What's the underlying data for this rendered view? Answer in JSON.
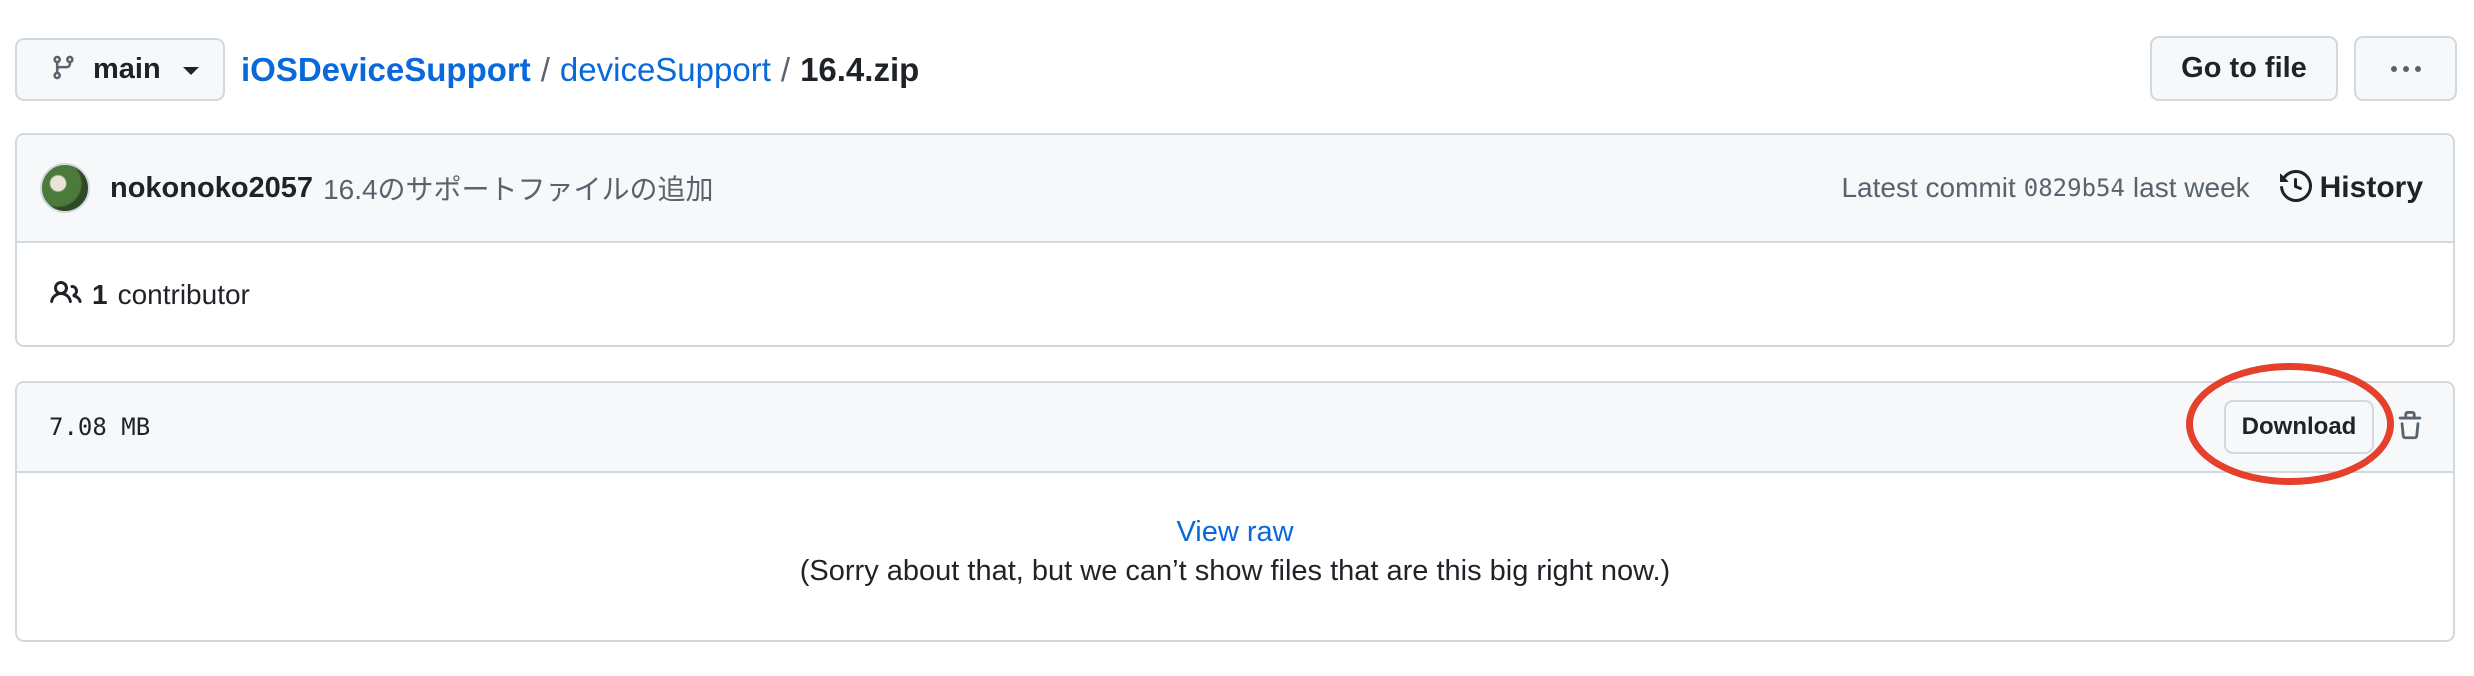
{
  "branch": {
    "name": "main"
  },
  "breadcrumb": {
    "repo": "iOSDeviceSupport",
    "folder": "deviceSupport",
    "file": "16.4.zip",
    "separator": "/"
  },
  "header_actions": {
    "goto_label": "Go to file",
    "more_icon": "kebab-horizontal-icon"
  },
  "commit": {
    "author": "nokonoko2057",
    "message": "16.4のサポートファイルの追加",
    "latest_label": "Latest commit",
    "sha": "0829b54",
    "when": "last week",
    "history_label": "History"
  },
  "contributors": {
    "count": "1",
    "label": "contributor"
  },
  "file": {
    "size": "7.08 MB",
    "download_label": "Download",
    "view_raw_label": "View raw",
    "sorry_text": "(Sorry about that, but we can’t show files that are this big right now.)"
  },
  "colors": {
    "link": "#0969da",
    "annotation_ring": "#e4402b",
    "border": "#d1d9e0",
    "header_bg": "#f6f8fa"
  }
}
